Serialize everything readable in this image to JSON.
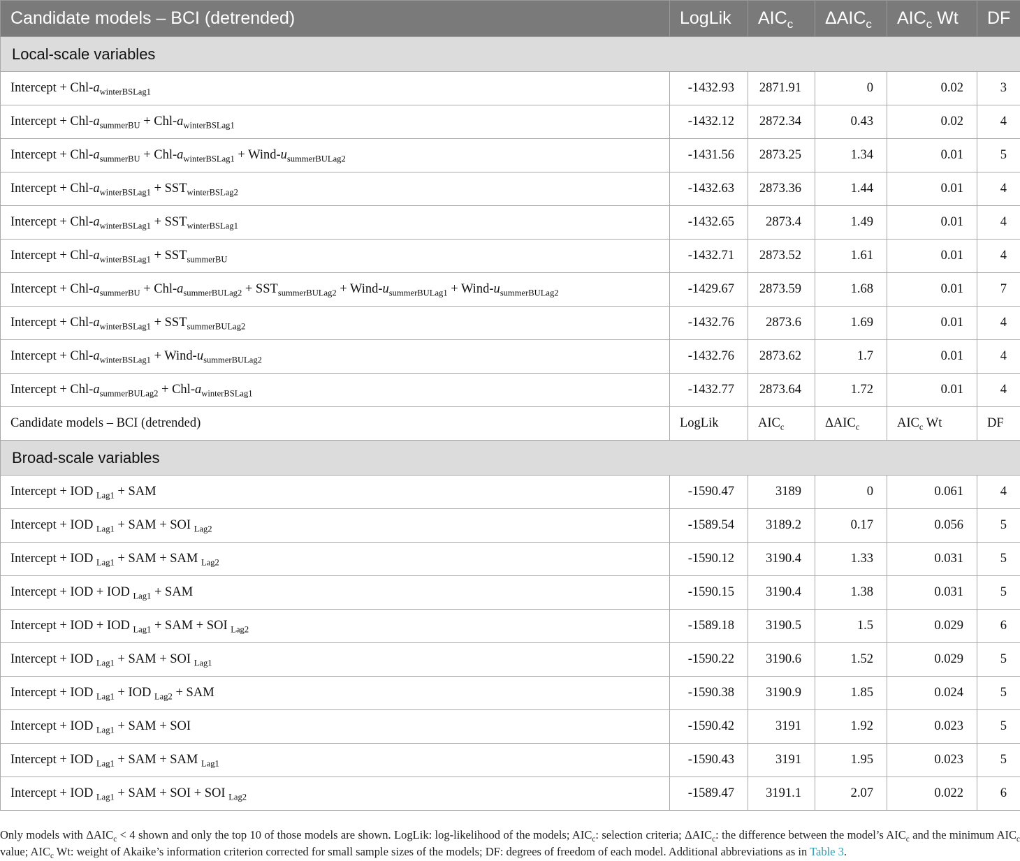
{
  "header": {
    "title": "Candidate models – BCI (detrended)",
    "loglik": "LogLik",
    "aicc_base": "AIC",
    "aicc_sub": "c",
    "daicc_base": "ΔAIC",
    "daicc_sub": "c",
    "wt_base": "AIC",
    "wt_sub": "c",
    "wt_tail": " Wt",
    "df": "DF"
  },
  "sections": {
    "local": "Local-scale variables",
    "broad": "Broad-scale variables"
  },
  "local_rows": [
    {
      "model": [
        [
          "t",
          "Intercept + Chl-"
        ],
        [
          "i",
          "a"
        ],
        [
          "s",
          "winterBSLag1"
        ]
      ],
      "loglik": "-1432.93",
      "aicc": "2871.91",
      "daicc": "0",
      "wt": "0.02",
      "df": "3"
    },
    {
      "model": [
        [
          "t",
          "Intercept + Chl-"
        ],
        [
          "i",
          "a"
        ],
        [
          "s",
          "summerBU"
        ],
        [
          "t",
          " + Chl-"
        ],
        [
          "i",
          "a"
        ],
        [
          "s",
          "winterBSLag1"
        ]
      ],
      "loglik": "-1432.12",
      "aicc": "2872.34",
      "daicc": "0.43",
      "wt": "0.02",
      "df": "4"
    },
    {
      "model": [
        [
          "t",
          "Intercept + Chl-"
        ],
        [
          "i",
          "a"
        ],
        [
          "s",
          "summerBU"
        ],
        [
          "t",
          " + Chl-"
        ],
        [
          "i",
          "a"
        ],
        [
          "s",
          "winterBSLag1"
        ],
        [
          "t",
          " + Wind-"
        ],
        [
          "i",
          "u"
        ],
        [
          "s",
          "summerBULag2"
        ]
      ],
      "loglik": "-1431.56",
      "aicc": "2873.25",
      "daicc": "1.34",
      "wt": "0.01",
      "df": "5"
    },
    {
      "model": [
        [
          "t",
          "Intercept + Chl-"
        ],
        [
          "i",
          "a"
        ],
        [
          "s",
          "winterBSLag1"
        ],
        [
          "t",
          " + SST"
        ],
        [
          "s",
          "winterBSLag2"
        ]
      ],
      "loglik": "-1432.63",
      "aicc": "2873.36",
      "daicc": "1.44",
      "wt": "0.01",
      "df": "4"
    },
    {
      "model": [
        [
          "t",
          "Intercept + Chl-"
        ],
        [
          "i",
          "a"
        ],
        [
          "s",
          "winterBSLag1"
        ],
        [
          "t",
          " + SST"
        ],
        [
          "s",
          "winterBSLag1"
        ]
      ],
      "loglik": "-1432.65",
      "aicc": "2873.4",
      "daicc": "1.49",
      "wt": "0.01",
      "df": "4"
    },
    {
      "model": [
        [
          "t",
          "Intercept + Chl-"
        ],
        [
          "i",
          "a"
        ],
        [
          "s",
          "winterBSLag1"
        ],
        [
          "t",
          " + SST"
        ],
        [
          "s",
          "summerBU"
        ]
      ],
      "loglik": "-1432.71",
      "aicc": "2873.52",
      "daicc": "1.61",
      "wt": "0.01",
      "df": "4"
    },
    {
      "model": [
        [
          "t",
          "Intercept + Chl-"
        ],
        [
          "i",
          "a"
        ],
        [
          "s",
          "summerBU"
        ],
        [
          "t",
          " + Chl-"
        ],
        [
          "i",
          "a"
        ],
        [
          "s",
          "summerBULag2"
        ],
        [
          "t",
          " + SST"
        ],
        [
          "s",
          "summerBULag2"
        ],
        [
          "t",
          " + Wind-"
        ],
        [
          "i",
          "u"
        ],
        [
          "s",
          "summerBULag1"
        ],
        [
          "t",
          " + Wind-"
        ],
        [
          "i",
          "u"
        ],
        [
          "s",
          "summerBULag2"
        ]
      ],
      "loglik": "-1429.67",
      "aicc": "2873.59",
      "daicc": "1.68",
      "wt": "0.01",
      "df": "7"
    },
    {
      "model": [
        [
          "t",
          "Intercept + Chl-"
        ],
        [
          "i",
          "a"
        ],
        [
          "s",
          "winterBSLag1"
        ],
        [
          "t",
          " + SST"
        ],
        [
          "s",
          "summerBULag2"
        ]
      ],
      "loglik": "-1432.76",
      "aicc": "2873.6",
      "daicc": "1.69",
      "wt": "0.01",
      "df": "4"
    },
    {
      "model": [
        [
          "t",
          "Intercept + Chl-"
        ],
        [
          "i",
          "a"
        ],
        [
          "s",
          "winterBSLag1"
        ],
        [
          "t",
          " + Wind-"
        ],
        [
          "i",
          "u"
        ],
        [
          "s",
          "summerBULag2"
        ]
      ],
      "loglik": "-1432.76",
      "aicc": "2873.62",
      "daicc": "1.7",
      "wt": "0.01",
      "df": "4"
    },
    {
      "model": [
        [
          "t",
          "Intercept + Chl-"
        ],
        [
          "i",
          "a"
        ],
        [
          "s",
          "summerBULag2"
        ],
        [
          "t",
          " + Chl-"
        ],
        [
          "i",
          "a"
        ],
        [
          "s",
          "winterBSLag1"
        ]
      ],
      "loglik": "-1432.77",
      "aicc": "2873.64",
      "daicc": "1.72",
      "wt": "0.01",
      "df": "4"
    }
  ],
  "repeat_header": {
    "title": "Candidate models – BCI (detrended)",
    "loglik": "LogLik",
    "aicc_base": "AIC",
    "aicc_sub": "c",
    "daicc_base": "ΔAIC",
    "daicc_sub": "c",
    "wt_base": "AIC",
    "wt_sub": "c",
    "wt_tail": " Wt",
    "df": "DF"
  },
  "broad_rows": [
    {
      "model": [
        [
          "t",
          "Intercept + IOD "
        ],
        [
          "s",
          "Lag1"
        ],
        [
          "t",
          " + SAM"
        ]
      ],
      "loglik": "-1590.47",
      "aicc": "3189",
      "daicc": "0",
      "wt": "0.061",
      "df": "4"
    },
    {
      "model": [
        [
          "t",
          "Intercept + IOD "
        ],
        [
          "s",
          "Lag1"
        ],
        [
          "t",
          " + SAM + SOI "
        ],
        [
          "s",
          "Lag2"
        ]
      ],
      "loglik": "-1589.54",
      "aicc": "3189.2",
      "daicc": "0.17",
      "wt": "0.056",
      "df": "5"
    },
    {
      "model": [
        [
          "t",
          "Intercept + IOD "
        ],
        [
          "s",
          "Lag1"
        ],
        [
          "t",
          " + SAM + SAM "
        ],
        [
          "s",
          "Lag2"
        ]
      ],
      "loglik": "-1590.12",
      "aicc": "3190.4",
      "daicc": "1.33",
      "wt": "0.031",
      "df": "5"
    },
    {
      "model": [
        [
          "t",
          "Intercept + IOD + IOD "
        ],
        [
          "s",
          "Lag1"
        ],
        [
          "t",
          " + SAM"
        ]
      ],
      "loglik": "-1590.15",
      "aicc": "3190.4",
      "daicc": "1.38",
      "wt": "0.031",
      "df": "5"
    },
    {
      "model": [
        [
          "t",
          "Intercept + IOD + IOD "
        ],
        [
          "s",
          "Lag1"
        ],
        [
          "t",
          " + SAM + SOI "
        ],
        [
          "s",
          "Lag2"
        ]
      ],
      "loglik": "-1589.18",
      "aicc": "3190.5",
      "daicc": "1.5",
      "wt": "0.029",
      "df": "6"
    },
    {
      "model": [
        [
          "t",
          "Intercept + IOD "
        ],
        [
          "s",
          "Lag1"
        ],
        [
          "t",
          " + SAM + SOI "
        ],
        [
          "s",
          "Lag1"
        ]
      ],
      "loglik": "-1590.22",
      "aicc": "3190.6",
      "daicc": "1.52",
      "wt": "0.029",
      "df": "5"
    },
    {
      "model": [
        [
          "t",
          "Intercept + IOD "
        ],
        [
          "s",
          "Lag1"
        ],
        [
          "t",
          " + IOD "
        ],
        [
          "s",
          "Lag2"
        ],
        [
          "t",
          " + SAM"
        ]
      ],
      "loglik": "-1590.38",
      "aicc": "3190.9",
      "daicc": "1.85",
      "wt": "0.024",
      "df": "5"
    },
    {
      "model": [
        [
          "t",
          "Intercept + IOD "
        ],
        [
          "s",
          "Lag1"
        ],
        [
          "t",
          " + SAM + SOI"
        ]
      ],
      "loglik": "-1590.42",
      "aicc": "3191",
      "daicc": "1.92",
      "wt": "0.023",
      "df": "5"
    },
    {
      "model": [
        [
          "t",
          "Intercept + IOD "
        ],
        [
          "s",
          "Lag1"
        ],
        [
          "t",
          " + SAM + SAM "
        ],
        [
          "s",
          "Lag1"
        ]
      ],
      "loglik": "-1590.43",
      "aicc": "3191",
      "daicc": "1.95",
      "wt": "0.023",
      "df": "5"
    },
    {
      "model": [
        [
          "t",
          "Intercept + IOD "
        ],
        [
          "s",
          "Lag1"
        ],
        [
          "t",
          " + SAM + SOI + SOI "
        ],
        [
          "s",
          "Lag2"
        ]
      ],
      "loglik": "-1589.47",
      "aicc": "3191.1",
      "daicc": "2.07",
      "wt": "0.022",
      "df": "6"
    }
  ],
  "footnote": {
    "parts": [
      [
        "t",
        "Only models with ΔAIC"
      ],
      [
        "s",
        "c"
      ],
      [
        "t",
        " < 4 shown and only the top 10 of those models are shown. LogLik: log-likelihood of the models; AIC"
      ],
      [
        "s",
        "c"
      ],
      [
        "t",
        ": selection criteria; ΔAIC"
      ],
      [
        "s",
        "c"
      ],
      [
        "t",
        ": the difference between the model’s AIC"
      ],
      [
        "s",
        "c"
      ],
      [
        "t",
        " and the minimum AIC"
      ],
      [
        "s",
        "c"
      ],
      [
        "t",
        " value; AIC"
      ],
      [
        "s",
        "c"
      ],
      [
        "t",
        " Wt: weight of Akaike’s information criterion corrected for small sample sizes of the models; DF: degrees of freedom of each model. Additional abbreviations as in "
      ],
      [
        "l",
        "Table 3"
      ],
      [
        "t",
        "."
      ]
    ]
  }
}
